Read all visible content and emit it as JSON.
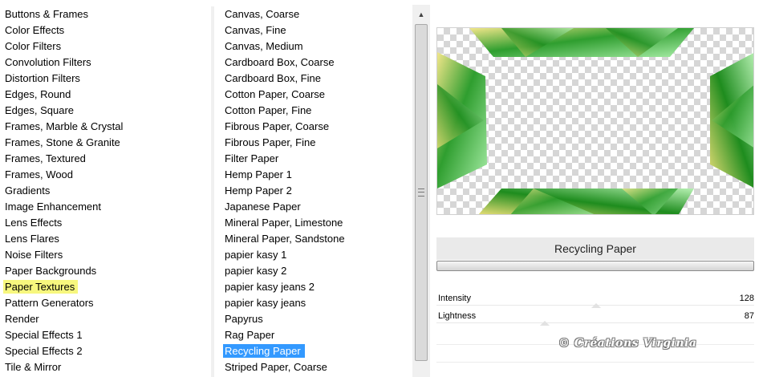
{
  "categories": [
    {
      "label": "Buttons & Frames"
    },
    {
      "label": "Color Effects"
    },
    {
      "label": "Color Filters"
    },
    {
      "label": "Convolution Filters"
    },
    {
      "label": "Distortion Filters"
    },
    {
      "label": "Edges, Round"
    },
    {
      "label": "Edges, Square"
    },
    {
      "label": "Frames, Marble & Crystal"
    },
    {
      "label": "Frames, Stone & Granite"
    },
    {
      "label": "Frames, Textured"
    },
    {
      "label": "Frames, Wood"
    },
    {
      "label": "Gradients"
    },
    {
      "label": "Image Enhancement"
    },
    {
      "label": "Lens Effects"
    },
    {
      "label": "Lens Flares"
    },
    {
      "label": "Noise Filters"
    },
    {
      "label": "Paper Backgrounds"
    },
    {
      "label": "Paper Textures",
      "highlighted": true
    },
    {
      "label": "Pattern Generators"
    },
    {
      "label": "Render"
    },
    {
      "label": "Special Effects 1"
    },
    {
      "label": "Special Effects 2"
    },
    {
      "label": "Tile & Mirror"
    }
  ],
  "filters": [
    {
      "label": "Canvas, Coarse"
    },
    {
      "label": "Canvas, Fine"
    },
    {
      "label": "Canvas, Medium"
    },
    {
      "label": "Cardboard Box, Coarse"
    },
    {
      "label": "Cardboard Box, Fine"
    },
    {
      "label": "Cotton Paper, Coarse"
    },
    {
      "label": "Cotton Paper, Fine"
    },
    {
      "label": "Fibrous Paper, Coarse"
    },
    {
      "label": "Fibrous Paper, Fine"
    },
    {
      "label": "Filter Paper"
    },
    {
      "label": "Hemp Paper 1"
    },
    {
      "label": "Hemp Paper 2"
    },
    {
      "label": "Japanese Paper"
    },
    {
      "label": "Mineral Paper, Limestone"
    },
    {
      "label": "Mineral Paper, Sandstone"
    },
    {
      "label": "papier kasy 1"
    },
    {
      "label": "papier kasy 2"
    },
    {
      "label": "papier kasy jeans 2"
    },
    {
      "label": "papier kasy jeans"
    },
    {
      "label": "Papyrus"
    },
    {
      "label": "Rag Paper"
    },
    {
      "label": "Recycling Paper",
      "selected": true
    },
    {
      "label": "Striped Paper, Coarse"
    }
  ],
  "selected_filter_name": "Recycling Paper",
  "params": {
    "intensity": {
      "label": "Intensity",
      "value": "128",
      "fraction": 0.502
    },
    "lightness": {
      "label": "Lightness",
      "value": "87",
      "fraction": 0.341
    }
  },
  "watermark": "© Créations Virginia",
  "colors": {
    "highlight": "#f7f77e",
    "selection": "#3399ff",
    "green_dark": "#1f8a1f",
    "green_light": "#9ee39a",
    "yellow": "#e8d86a"
  },
  "icons": {
    "scroll_up": "triangle-up-icon",
    "grip": "grip-icon"
  }
}
